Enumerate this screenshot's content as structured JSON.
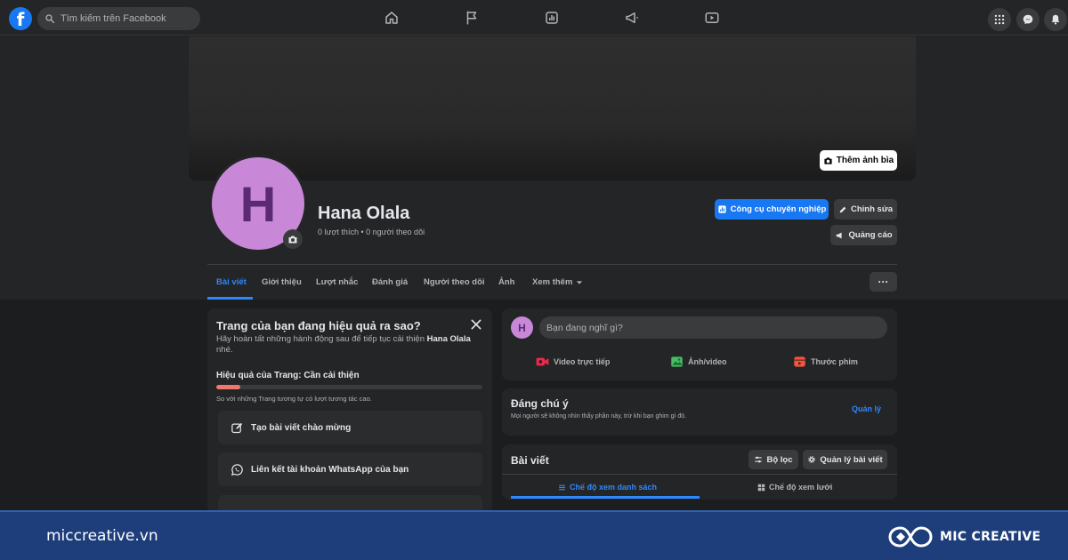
{
  "topbar": {
    "logo_letter": "f",
    "search": {
      "placeholder": "Tìm kiếm trên Facebook"
    },
    "nav_icons": [
      "home-icon",
      "flag-icon",
      "insights-icon",
      "megaphone-icon",
      "video-icon"
    ],
    "right_icons": [
      "menu-grid-icon",
      "messenger-icon",
      "bell-icon"
    ]
  },
  "cover": {
    "add_cover_label": "Thêm ảnh bìa"
  },
  "profile": {
    "avatar_letter": "H",
    "name": "Hana Olala",
    "stats": "0 lượt thích • 0 người theo dõi",
    "avatar_color": "#c987d8",
    "buttons": {
      "pro_tools": "Công cụ chuyên nghiệp",
      "edit": "Chỉnh sửa",
      "ads": "Quảng cáo"
    }
  },
  "tabs": [
    {
      "label": "Bài viết",
      "active": true
    },
    {
      "label": "Giới thiệu"
    },
    {
      "label": "Lượt nhắc"
    },
    {
      "label": "Đánh giá"
    },
    {
      "label": "Người theo dõi"
    },
    {
      "label": "Ảnh"
    },
    {
      "label": "Xem thêm"
    }
  ],
  "tabs_more_label": "···",
  "performance": {
    "title": "Trang của bạn đang hiệu quả ra sao?",
    "desc_prefix": "Hãy hoàn tất những hành động sau để tiếp tục cải thiện",
    "desc_name": "Hana Olala",
    "desc_suffix": "nhé.",
    "label": "Hiệu quả của Trang: Cần cải thiện",
    "progress": 0.09,
    "note": "So với những Trang tương tự có lượt tương tác cao.",
    "tasks": [
      {
        "label": "Tạo bài viết chào mừng",
        "icon": "edit-icon"
      },
      {
        "label": "Liên kết tài khoản WhatsApp của bạn",
        "icon": "whatsapp-icon"
      }
    ]
  },
  "composer": {
    "avatar_letter": "H",
    "placeholder": "Bạn đang nghĩ gì?",
    "actions": [
      {
        "label": "Video trực tiếp",
        "icon": "live-video-icon",
        "color": "#f02849"
      },
      {
        "label": "Ảnh/video",
        "icon": "photo-icon",
        "color": "#45bd62"
      },
      {
        "label": "Thước phim",
        "icon": "reels-icon",
        "color": "#f5533d"
      }
    ]
  },
  "notice": {
    "title": "Đáng chú ý",
    "subtitle": "Mọi người sẽ không nhìn thấy phần này, trừ khi bạn ghim gì đó.",
    "link": "Quản lý"
  },
  "posts": {
    "title": "Bài viết",
    "filter_label": "Bộ lọc",
    "manage_label": "Quản lý bài viết",
    "views": [
      {
        "label": "Chế độ xem danh sách",
        "active": true
      },
      {
        "label": "Chế độ xem lưới"
      }
    ]
  },
  "footer": {
    "url": "miccreative.vn",
    "brand": "MIC CREATIVE"
  }
}
